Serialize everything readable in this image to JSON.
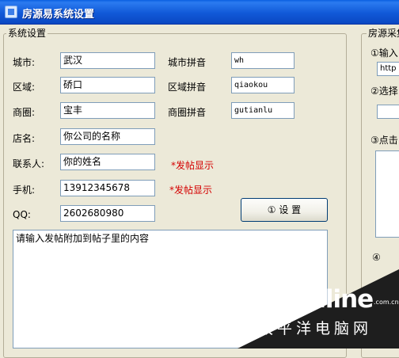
{
  "window": {
    "title": "房源易系统设置"
  },
  "settings": {
    "legend": "系统设置",
    "city": {
      "label": "城市:",
      "value": "武汉",
      "pinyin_label": "城市拼音",
      "pinyin": "wh"
    },
    "district": {
      "label": "区域:",
      "value": "硚口",
      "pinyin_label": "区域拼音",
      "pinyin": "qiaokou"
    },
    "area": {
      "label": "商圈:",
      "value": "宝丰",
      "pinyin_label": "商圈拼音",
      "pinyin": "gutianlu"
    },
    "shop": {
      "label": "店名:",
      "value": "你公司的名称"
    },
    "contact": {
      "label": "联系人:",
      "value": "你的姓名",
      "note": "*发帖显示"
    },
    "phone": {
      "label": "手机:",
      "value": "13912345678",
      "note": "*发帖显示"
    },
    "qq": {
      "label": "QQ:",
      "value": "2602680980"
    },
    "set_button": "① 设 置",
    "content_placeholder": "请输入发帖附加到帖子里的内容"
  },
  "right_panel": {
    "legend": "房源采集",
    "step1": "①输入",
    "url_value": "http",
    "step2": "②选择",
    "step3": "③点击",
    "step4": "④"
  },
  "watermark": {
    "logo": "PConline",
    "domain": ".com.cn",
    "cn_text": "太平洋电脑网"
  }
}
